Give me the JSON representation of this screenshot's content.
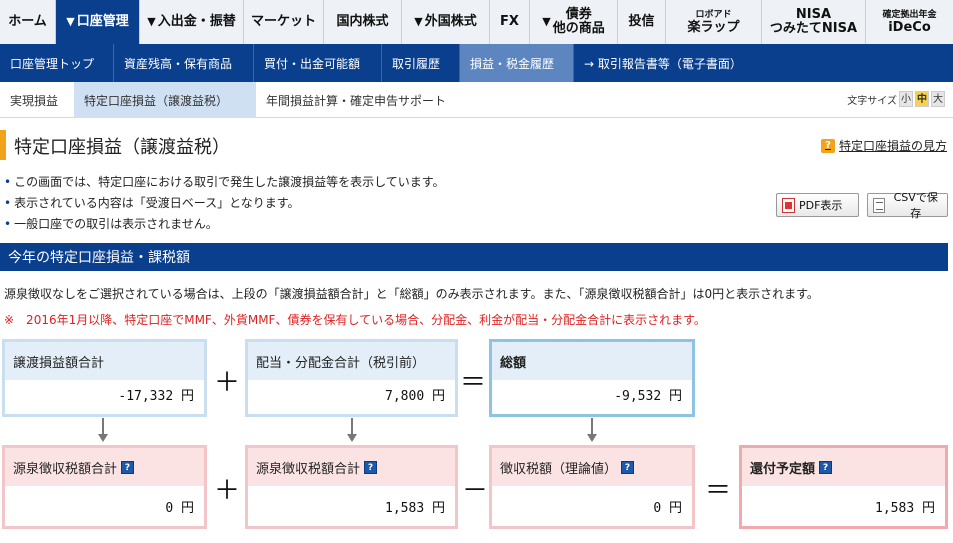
{
  "top_nav": [
    {
      "label": "ホーム"
    },
    {
      "label": "口座管理",
      "dropdown": true,
      "active": true
    },
    {
      "label": "入出金・振替",
      "dropdown": true
    },
    {
      "label": "マーケット"
    },
    {
      "label": "国内株式"
    },
    {
      "label": "外国株式",
      "dropdown": true
    },
    {
      "label": "FX"
    },
    {
      "label": "債券",
      "label2": "他の商品",
      "dropdown": true
    },
    {
      "label": "投信"
    },
    {
      "small": "ロボアド",
      "label": "楽ラップ"
    },
    {
      "label": "NISA",
      "label2": "つみたてNISA"
    },
    {
      "small": "確定拠出年金",
      "label": "iDeCo"
    }
  ],
  "sub_nav": [
    {
      "label": "口座管理トップ"
    },
    {
      "label": "資産残高・保有商品"
    },
    {
      "label": "買付・出金可能額"
    },
    {
      "label": "取引履歴"
    },
    {
      "label": "損益・税金履歴",
      "active": true
    },
    {
      "label": "→ 取引報告書等（電子書面）"
    }
  ],
  "tabs": [
    {
      "label": "実現損益"
    },
    {
      "label": "特定口座損益（譲渡益税）",
      "active": true
    },
    {
      "label": "年間損益計算・確定申告サポート"
    }
  ],
  "font_size": {
    "label": "文字サイズ",
    "options": [
      "小",
      "中",
      "大"
    ],
    "selected": "中"
  },
  "page": {
    "title": "特定口座損益（譲渡益税）",
    "help_link": "特定口座損益の見方",
    "help_icon": "?",
    "notes": [
      "この画面では、特定口座における取引で発生した譲渡損益等を表示しています。",
      "表示されている内容は「受渡日ベース」となります。",
      "一般口座での取引は表示されません。"
    ],
    "pdf_button": "PDF表示",
    "csv_button": "CSVで保存"
  },
  "section": {
    "header": "今年の特定口座損益・課税額",
    "info": "源泉徴収なしをご選択されている場合は、上段の「譲渡損益額合計」と「総額」のみ表示されます。また、「源泉徴収税額合計」は0円と表示されます。",
    "warning": "※　2016年1月以降、特定口座でMMF、外貨MMF、債券を保有している場合、分配金、利金が配当・分配金合計に表示されます。"
  },
  "row1": {
    "transfer_total": {
      "label": "譲渡損益額合計",
      "value": "-17,332 円"
    },
    "op_plus": "＋",
    "dividend_total": {
      "label": "配当・分配金合計（税引前）",
      "value": "7,800 円"
    },
    "op_equals": "＝",
    "grand_total": {
      "label": "総額",
      "value": "-9,532 円"
    }
  },
  "row2": {
    "withholding_a": {
      "label": "源泉徴収税額合計",
      "value": "0 円"
    },
    "op_plus": "＋",
    "withholding_b": {
      "label": "源泉徴収税額合計",
      "value": "1,583 円"
    },
    "op_minus": "－",
    "theoretical_tax": {
      "label": "徴収税額（理論値）",
      "value": "0 円"
    },
    "op_equals": "＝",
    "refund": {
      "label": "還付予定額",
      "value": "1,583 円"
    }
  },
  "help_icon_glyph": "?"
}
